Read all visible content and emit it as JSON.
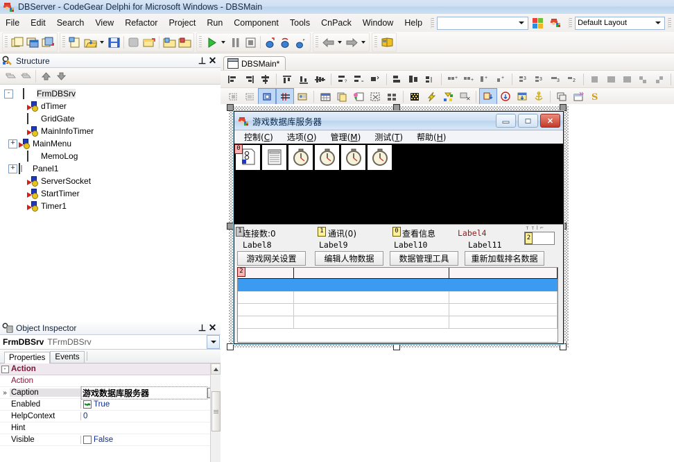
{
  "window": {
    "title": "DBServer - CodeGear Delphi for Microsoft Windows - DBSMain",
    "icon": "delphi-icon"
  },
  "menubar": {
    "items": [
      "File",
      "Edit",
      "Search",
      "View",
      "Refactor",
      "Project",
      "Run",
      "Component",
      "Tools",
      "CnPack",
      "Window",
      "Help"
    ],
    "search_combo_value": "",
    "layout_combo_value": "Default Layout"
  },
  "toolbar": {
    "groups": [
      {
        "name": "view-group",
        "buttons": [
          "new-form-icon",
          "window-list-icon",
          "toggle-form-unit-icon"
        ]
      },
      {
        "name": "standard-group",
        "buttons": [
          "new-icon",
          "open-icon",
          "open-dropdown-icon",
          "save-icon",
          "save-all-icon",
          "open-project-icon",
          "add-file-icon",
          "remove-file-icon"
        ]
      },
      {
        "name": "debug-group",
        "buttons": [
          "run-icon",
          "run-dropdown-icon",
          "pause-icon",
          "stop-icon",
          "trace-into-icon",
          "step-over-icon",
          "run-to-cursor-icon"
        ]
      },
      {
        "name": "navigate-group",
        "buttons": [
          "back-icon",
          "back-dropdown-icon",
          "forward-icon",
          "forward-dropdown-icon"
        ]
      },
      {
        "name": "help-group",
        "buttons": [
          "help-icon"
        ]
      }
    ]
  },
  "structure": {
    "title": "Structure",
    "icon": "structure-icon",
    "pin_icon": "pin-icon",
    "close_icon": "close-icon",
    "toolbar": [
      "collapse-all-icon",
      "expand-all-icon",
      "move-up-icon",
      "move-down-icon"
    ],
    "tree": [
      {
        "label": "FrmDBSrv",
        "level": 0,
        "expander": "-",
        "icon": "form-icon",
        "selected": true
      },
      {
        "label": "dTimer",
        "level": 1,
        "expander": "",
        "icon": "nonvisual-icon",
        "selected": false
      },
      {
        "label": "GridGate",
        "level": 1,
        "expander": "",
        "icon": "control-icon",
        "selected": false
      },
      {
        "label": "MainInfoTimer",
        "level": 1,
        "expander": "",
        "icon": "nonvisual-icon",
        "selected": false
      },
      {
        "label": "MainMenu",
        "level": 1,
        "expander": "+",
        "icon": "nonvisual-icon",
        "selected": false
      },
      {
        "label": "MemoLog",
        "level": 1,
        "expander": "",
        "icon": "control-icon",
        "selected": false
      },
      {
        "label": "Panel1",
        "level": 1,
        "expander": "+",
        "icon": "panel-icon",
        "selected": false
      },
      {
        "label": "ServerSocket",
        "level": 1,
        "expander": "",
        "icon": "nonvisual-icon",
        "selected": false
      },
      {
        "label": "StartTimer",
        "level": 1,
        "expander": "",
        "icon": "nonvisual-icon",
        "selected": false
      },
      {
        "label": "Timer1",
        "level": 1,
        "expander": "",
        "icon": "nonvisual-icon",
        "selected": false
      }
    ]
  },
  "object_inspector": {
    "title": "Object Inspector",
    "icon": "object-inspector-icon",
    "pin_icon": "pin-icon",
    "close_icon": "close-icon",
    "selected_object": "FrmDBSrv",
    "selected_class": "TFrmDBSrv",
    "tabs": [
      {
        "label": "Properties",
        "active": true
      },
      {
        "label": "Events",
        "active": false
      }
    ],
    "rows": [
      {
        "name": "Action",
        "value": "",
        "kind": "category",
        "expander": "-"
      },
      {
        "name": "Action",
        "value": "",
        "kind": "catitem"
      },
      {
        "name": "Caption",
        "value": "游戏数据库服务器",
        "kind": "caption",
        "selected": true,
        "ellipsis": "..."
      },
      {
        "name": "Enabled",
        "value": "True",
        "kind": "checkbox",
        "checked": true
      },
      {
        "name": "HelpContext",
        "value": "0",
        "kind": "text"
      },
      {
        "name": "Hint",
        "value": "",
        "kind": "text"
      },
      {
        "name": "Visible",
        "value": "False",
        "kind": "checkbox",
        "checked": false
      }
    ]
  },
  "editor": {
    "tab": {
      "label": "DBSMain*",
      "icon": "form-file-icon"
    },
    "align_toolbar_rows": 2
  },
  "design_form": {
    "caption": "游戏数据库服务器",
    "icon": "app-icon",
    "caption_buttons": [
      {
        "name": "minimize-button",
        "glyph": "—"
      },
      {
        "name": "maximize-button",
        "glyph": "❐"
      },
      {
        "name": "close-button",
        "glyph": "✕"
      }
    ],
    "menu": [
      {
        "text": "控制(",
        "hot": "C",
        "tail": ")"
      },
      {
        "text": "选项(",
        "hot": "O",
        "tail": ")"
      },
      {
        "text": "管理(",
        "hot": "M",
        "tail": ")"
      },
      {
        "text": "测试(",
        "hot": "T",
        "tail": ")"
      },
      {
        "text": "帮助(",
        "hot": "H",
        "tail": ")"
      }
    ],
    "toolbar_marker": "0",
    "toolbar_buttons": [
      "log-document-icon",
      "list-icon",
      "clock-icon",
      "clock-icon",
      "clock-icon",
      "clock-icon"
    ],
    "labels_row1": [
      {
        "text": "连接数:0",
        "marker": "1",
        "marker_style": "grey"
      },
      {
        "text": "通讯(0)",
        "marker": "1",
        "marker_style": "yellow"
      },
      {
        "text": "查看信息",
        "marker": "0",
        "marker_style": "yellow"
      },
      {
        "text": "Label4",
        "marker": "",
        "marker_style": "none"
      }
    ],
    "labels_row2": [
      "Label8",
      "Label9",
      "Label10",
      "Label11"
    ],
    "buttons": [
      "游戏网关设置",
      "编辑人物数据",
      "数据管理工具",
      "重新加载排名数据"
    ],
    "edit_marker": "2",
    "edit_value": "",
    "grid_marker": "2",
    "grid": {
      "columns": 3,
      "rows": [
        {
          "selected": false
        },
        {
          "selected": true
        },
        {
          "selected": false
        },
        {
          "selected": false
        },
        {
          "selected": false
        },
        {
          "selected": false
        }
      ]
    }
  },
  "colors": {
    "title_bar": "#cfe0f2",
    "selection_blue": "#3b9bf0",
    "category_text": "#7a1436",
    "value_text": "#0b2d91",
    "form_body": "#000000",
    "close_button": "#c33a27"
  }
}
